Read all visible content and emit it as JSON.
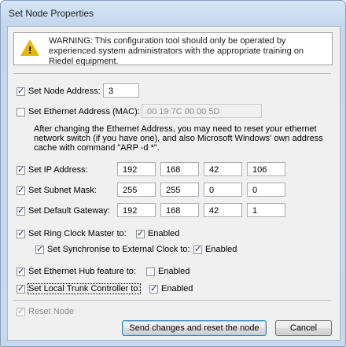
{
  "window": {
    "title": "Set Node Properties"
  },
  "warning": {
    "icon": "warning-icon",
    "text": "WARNING: This configuration tool should only be operated by experienced system administrators with the appropriate training on Riedel equipment."
  },
  "node_address": {
    "label": "Set Node Address:",
    "checked": true,
    "value": "3"
  },
  "ethernet_address": {
    "label": "Set Ethernet Address (MAC):",
    "checked": false,
    "value": "00 19 7C 00 00 5D"
  },
  "ethernet_note": "After changing the Ethernet Address, you may need to reset your ethernet network switch (if you have one), and also Microsoft Windows' own address cache with command \"ARP -d *\".",
  "ip_address": {
    "label": "Set IP Address:",
    "checked": true,
    "octets": [
      "192",
      "168",
      "42",
      "106"
    ]
  },
  "subnet_mask": {
    "label": "Set Subnet Mask:",
    "checked": true,
    "octets": [
      "255",
      "255",
      "0",
      "0"
    ]
  },
  "default_gateway": {
    "label": "Set Default Gateway:",
    "checked": true,
    "octets": [
      "192",
      "168",
      "42",
      "1"
    ]
  },
  "ring_clock": {
    "label": "Set Ring Clock Master to:",
    "checked": true,
    "enabled_label": "Enabled",
    "enabled_checked": true
  },
  "sync_clock": {
    "label": "Set Synchronise to External Clock to:",
    "checked": true,
    "enabled_label": "Enabled",
    "enabled_checked": true
  },
  "ethernet_hub": {
    "label": "Set Ethernet Hub feature to:",
    "checked": true,
    "enabled_label": "Enabled",
    "enabled_checked": false
  },
  "local_trunk": {
    "label": "Set Local Trunk Controller to:",
    "checked": true,
    "enabled_label": "Enabled",
    "enabled_checked": true
  },
  "reset_node": {
    "label": "Reset Node",
    "checked": true
  },
  "buttons": {
    "send": "Send changes and reset the node",
    "cancel": "Cancel"
  }
}
